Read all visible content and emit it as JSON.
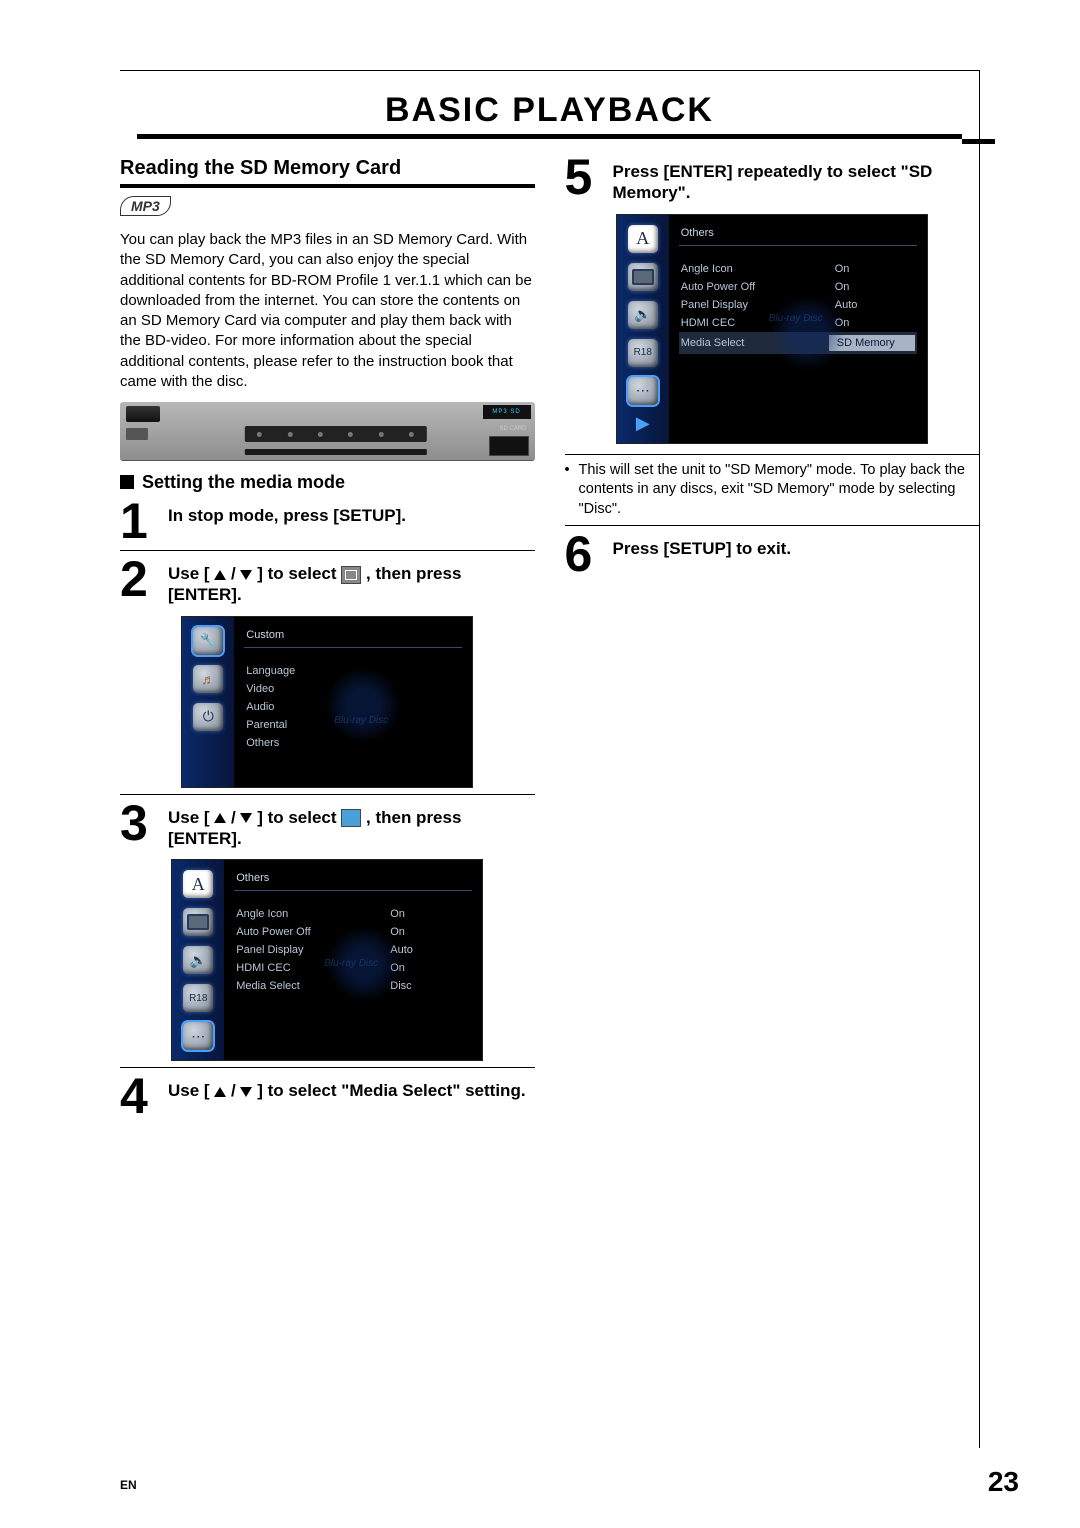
{
  "page": {
    "title": "BASIC PLAYBACK",
    "language_code": "EN",
    "page_number": "23"
  },
  "left": {
    "section_title": "Reading the SD Memory Card",
    "format_badge": "MP3",
    "intro_para": "You can play back the MP3 files in an SD Memory Card. With the SD Memory Card, you can also enjoy the special additional contents for BD-ROM Profile 1 ver.1.1 which can be downloaded from the internet. You can store the contents on an SD Memory Card via computer and play them back with the BD-video. For more information about the special additional contents, please refer to the instruction book that came with the disc.",
    "device": {
      "panel_text": "MP3 SD",
      "sd_label": "SD CARD"
    },
    "subhead": "Setting the media mode",
    "step1": {
      "num": "1",
      "text": "In stop mode, press [SETUP]."
    },
    "step2": {
      "num": "2",
      "pre": "Use [ ",
      "mid": " / ",
      "post_a": " ] to select ",
      "post_b": " , then press [ENTER]."
    },
    "osd2": {
      "category": "Custom",
      "items": [
        "Language",
        "Video",
        "Audio",
        "Parental",
        "Others"
      ],
      "wm": "Blu-ray Disc"
    },
    "step3": {
      "num": "3",
      "pre": "Use [ ",
      "mid": " / ",
      "post_a": " ] to select ",
      "post_b": " , then press [ENTER]."
    },
    "osd3": {
      "category": "Others",
      "rows": [
        {
          "k": "Angle Icon",
          "v": "On"
        },
        {
          "k": "Auto Power Off",
          "v": "On"
        },
        {
          "k": "Panel Display",
          "v": "Auto"
        },
        {
          "k": "HDMI CEC",
          "v": "On"
        },
        {
          "k": "Media Select",
          "v": "Disc"
        }
      ],
      "wm": "Blu-ray Disc"
    },
    "step4": {
      "num": "4",
      "pre": "Use [ ",
      "mid": " / ",
      "post": " ] to select \"Media Select\" setting."
    }
  },
  "right": {
    "step5": {
      "num": "5",
      "text": "Press [ENTER] repeatedly to select \"SD Memory\"."
    },
    "osd5": {
      "category": "Others",
      "rows": [
        {
          "k": "Angle Icon",
          "v": "On"
        },
        {
          "k": "Auto Power Off",
          "v": "On"
        },
        {
          "k": "Panel Display",
          "v": "Auto"
        },
        {
          "k": "HDMI CEC",
          "v": "On"
        },
        {
          "k": "Media Select",
          "v": "SD Memory",
          "sel": true
        }
      ],
      "wm": "Blu-ray Disc"
    },
    "note": "This will set the unit to \"SD Memory\" mode. To play back the contents in any discs, exit \"SD Memory\" mode by selecting \"Disc\".",
    "step6": {
      "num": "6",
      "text": "Press [SETUP] to exit."
    }
  }
}
